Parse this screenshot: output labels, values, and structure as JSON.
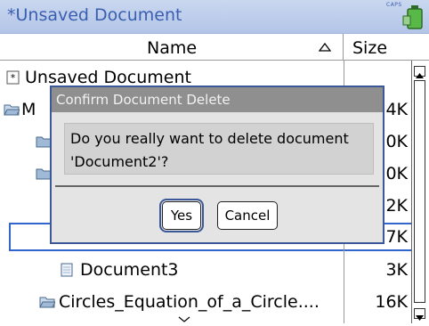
{
  "window": {
    "title": "*Unsaved Document",
    "caps_indicator": "CAPS"
  },
  "header": {
    "name_label": "Name",
    "size_label": "Size"
  },
  "rows": [
    {
      "name": "Unsaved Document",
      "size": "",
      "icon": "document-star-icon"
    },
    {
      "name": "M",
      "size": "4K",
      "icon": "folder-open-icon"
    },
    {
      "name": "",
      "size": "0K",
      "icon": "folder-icon"
    },
    {
      "name": "",
      "size": "0K",
      "icon": "folder-icon"
    },
    {
      "name": "",
      "size": "2K",
      "icon": "document-icon"
    },
    {
      "name": "",
      "size": "7K",
      "icon": "document-icon"
    },
    {
      "name": "Document3",
      "size": "3K",
      "icon": "document-icon"
    },
    {
      "name": "Circles_Equation_of_a_Circle....",
      "size": "16K",
      "icon": "folder-open-icon"
    }
  ],
  "dialog": {
    "title": "Confirm Document Delete",
    "message_line1": "Do you really want to delete document",
    "message_line2": "'Document2'?",
    "yes_label": "Yes",
    "cancel_label": "Cancel"
  },
  "colors": {
    "titlebar": "#b3c5e8",
    "title_text": "#3a5fb0",
    "selection": "#3366cc",
    "dialog_border": "#3b5998",
    "dialog_title_bg": "#8f8f8f"
  }
}
